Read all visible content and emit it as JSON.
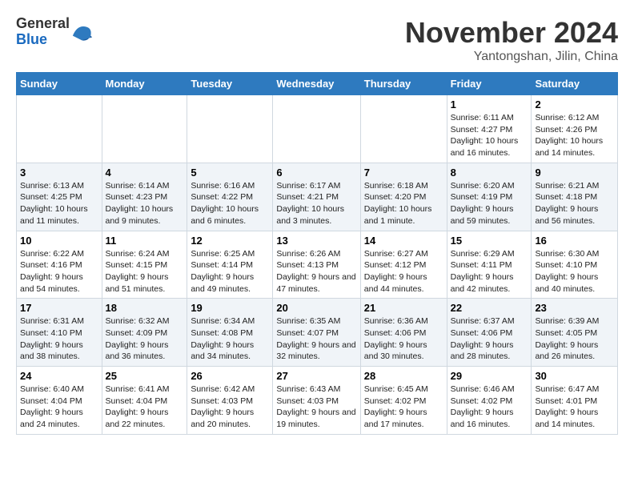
{
  "header": {
    "logo_line1": "General",
    "logo_line2": "Blue",
    "month": "November 2024",
    "location": "Yantongshan, Jilin, China"
  },
  "weekdays": [
    "Sunday",
    "Monday",
    "Tuesday",
    "Wednesday",
    "Thursday",
    "Friday",
    "Saturday"
  ],
  "weeks": [
    [
      {
        "day": "",
        "info": ""
      },
      {
        "day": "",
        "info": ""
      },
      {
        "day": "",
        "info": ""
      },
      {
        "day": "",
        "info": ""
      },
      {
        "day": "",
        "info": ""
      },
      {
        "day": "1",
        "info": "Sunrise: 6:11 AM\nSunset: 4:27 PM\nDaylight: 10 hours\nand 16 minutes."
      },
      {
        "day": "2",
        "info": "Sunrise: 6:12 AM\nSunset: 4:26 PM\nDaylight: 10 hours\nand 14 minutes."
      }
    ],
    [
      {
        "day": "3",
        "info": "Sunrise: 6:13 AM\nSunset: 4:25 PM\nDaylight: 10 hours\nand 11 minutes."
      },
      {
        "day": "4",
        "info": "Sunrise: 6:14 AM\nSunset: 4:23 PM\nDaylight: 10 hours\nand 9 minutes."
      },
      {
        "day": "5",
        "info": "Sunrise: 6:16 AM\nSunset: 4:22 PM\nDaylight: 10 hours\nand 6 minutes."
      },
      {
        "day": "6",
        "info": "Sunrise: 6:17 AM\nSunset: 4:21 PM\nDaylight: 10 hours\nand 3 minutes."
      },
      {
        "day": "7",
        "info": "Sunrise: 6:18 AM\nSunset: 4:20 PM\nDaylight: 10 hours\nand 1 minute."
      },
      {
        "day": "8",
        "info": "Sunrise: 6:20 AM\nSunset: 4:19 PM\nDaylight: 9 hours\nand 59 minutes."
      },
      {
        "day": "9",
        "info": "Sunrise: 6:21 AM\nSunset: 4:18 PM\nDaylight: 9 hours\nand 56 minutes."
      }
    ],
    [
      {
        "day": "10",
        "info": "Sunrise: 6:22 AM\nSunset: 4:16 PM\nDaylight: 9 hours\nand 54 minutes."
      },
      {
        "day": "11",
        "info": "Sunrise: 6:24 AM\nSunset: 4:15 PM\nDaylight: 9 hours\nand 51 minutes."
      },
      {
        "day": "12",
        "info": "Sunrise: 6:25 AM\nSunset: 4:14 PM\nDaylight: 9 hours\nand 49 minutes."
      },
      {
        "day": "13",
        "info": "Sunrise: 6:26 AM\nSunset: 4:13 PM\nDaylight: 9 hours\nand 47 minutes."
      },
      {
        "day": "14",
        "info": "Sunrise: 6:27 AM\nSunset: 4:12 PM\nDaylight: 9 hours\nand 44 minutes."
      },
      {
        "day": "15",
        "info": "Sunrise: 6:29 AM\nSunset: 4:11 PM\nDaylight: 9 hours\nand 42 minutes."
      },
      {
        "day": "16",
        "info": "Sunrise: 6:30 AM\nSunset: 4:10 PM\nDaylight: 9 hours\nand 40 minutes."
      }
    ],
    [
      {
        "day": "17",
        "info": "Sunrise: 6:31 AM\nSunset: 4:10 PM\nDaylight: 9 hours\nand 38 minutes."
      },
      {
        "day": "18",
        "info": "Sunrise: 6:32 AM\nSunset: 4:09 PM\nDaylight: 9 hours\nand 36 minutes."
      },
      {
        "day": "19",
        "info": "Sunrise: 6:34 AM\nSunset: 4:08 PM\nDaylight: 9 hours\nand 34 minutes."
      },
      {
        "day": "20",
        "info": "Sunrise: 6:35 AM\nSunset: 4:07 PM\nDaylight: 9 hours\nand 32 minutes."
      },
      {
        "day": "21",
        "info": "Sunrise: 6:36 AM\nSunset: 4:06 PM\nDaylight: 9 hours\nand 30 minutes."
      },
      {
        "day": "22",
        "info": "Sunrise: 6:37 AM\nSunset: 4:06 PM\nDaylight: 9 hours\nand 28 minutes."
      },
      {
        "day": "23",
        "info": "Sunrise: 6:39 AM\nSunset: 4:05 PM\nDaylight: 9 hours\nand 26 minutes."
      }
    ],
    [
      {
        "day": "24",
        "info": "Sunrise: 6:40 AM\nSunset: 4:04 PM\nDaylight: 9 hours\nand 24 minutes."
      },
      {
        "day": "25",
        "info": "Sunrise: 6:41 AM\nSunset: 4:04 PM\nDaylight: 9 hours\nand 22 minutes."
      },
      {
        "day": "26",
        "info": "Sunrise: 6:42 AM\nSunset: 4:03 PM\nDaylight: 9 hours\nand 20 minutes."
      },
      {
        "day": "27",
        "info": "Sunrise: 6:43 AM\nSunset: 4:03 PM\nDaylight: 9 hours\nand 19 minutes."
      },
      {
        "day": "28",
        "info": "Sunrise: 6:45 AM\nSunset: 4:02 PM\nDaylight: 9 hours\nand 17 minutes."
      },
      {
        "day": "29",
        "info": "Sunrise: 6:46 AM\nSunset: 4:02 PM\nDaylight: 9 hours\nand 16 minutes."
      },
      {
        "day": "30",
        "info": "Sunrise: 6:47 AM\nSunset: 4:01 PM\nDaylight: 9 hours\nand 14 minutes."
      }
    ]
  ]
}
